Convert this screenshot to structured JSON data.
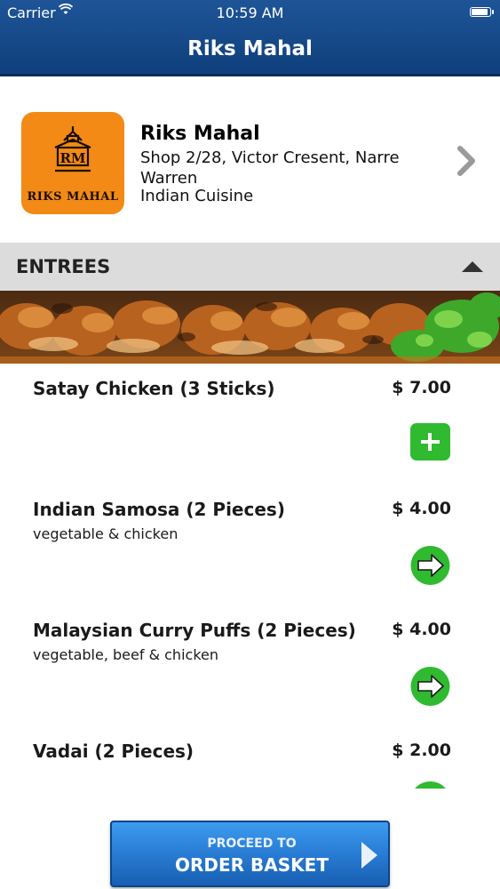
{
  "status_bar": {
    "carrier": "Carrier",
    "time": "10:59 AM",
    "battery_level": 0.95
  },
  "nav": {
    "title": "Riks Mahal"
  },
  "restaurant": {
    "logo_text": "RIKS MAHAL",
    "logo_monogram": "RM",
    "name": "Riks Mahal",
    "address": "Shop 2/28, Victor Cresent, Narre Warren",
    "cuisine": "Indian Cuisine"
  },
  "section": {
    "title": "ENTREES",
    "expanded": true
  },
  "menu_items": [
    {
      "name": "Satay Chicken (3 Sticks)",
      "description": "",
      "price": "$ 7.00",
      "action_icon": "plus-icon"
    },
    {
      "name": "Indian Samosa (2 Pieces)",
      "description": "vegetable & chicken",
      "price": "$ 4.00",
      "action_icon": "arrow-right-icon"
    },
    {
      "name": "Malaysian Curry Puffs (2 Pieces)",
      "description": "vegetable, beef & chicken",
      "price": "$ 4.00",
      "action_icon": "arrow-right-icon"
    },
    {
      "name": "Vadai (2 Pieces)",
      "description": "",
      "price": "$ 2.00",
      "action_icon": "arrow-right-icon"
    }
  ],
  "order_button": {
    "subtitle": "PROCEED TO",
    "label": "ORDER BASKET"
  },
  "colors": {
    "nav_bar": "#1e5597",
    "logo_bg": "#f28a15",
    "add_green": "#2fba2f",
    "section_bg": "#dcdcdc",
    "order_button": "#2a7fd6"
  }
}
